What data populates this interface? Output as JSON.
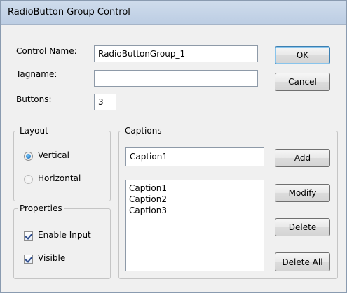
{
  "dialog": {
    "title": "RadioButton Group Control"
  },
  "fields": {
    "control_name_label": "Control Name:",
    "control_name_value": "RadioButtonGroup_1",
    "tagname_label": "Tagname:",
    "tagname_value": "",
    "buttons_label": "Buttons:",
    "buttons_value": "3"
  },
  "buttons": {
    "ok": "OK",
    "cancel": "Cancel",
    "add": "Add",
    "modify": "Modify",
    "delete": "Delete",
    "delete_all": "Delete All"
  },
  "layout_group": {
    "legend": "Layout",
    "vertical_label": "Vertical",
    "horizontal_label": "Horizontal",
    "selected": "Vertical"
  },
  "properties_group": {
    "legend": "Properties",
    "enable_input_label": "Enable Input",
    "enable_input_checked": true,
    "visible_label": "Visible",
    "visible_checked": true
  },
  "captions_group": {
    "legend": "Captions",
    "caption_input_value": "Caption1",
    "items": [
      "Caption1",
      "Caption2",
      "Caption3"
    ]
  },
  "colors": {
    "titlebar": "#c4d3e6",
    "window_bg": "#f0f0f0",
    "default_button_border": "#3c7fb1"
  }
}
